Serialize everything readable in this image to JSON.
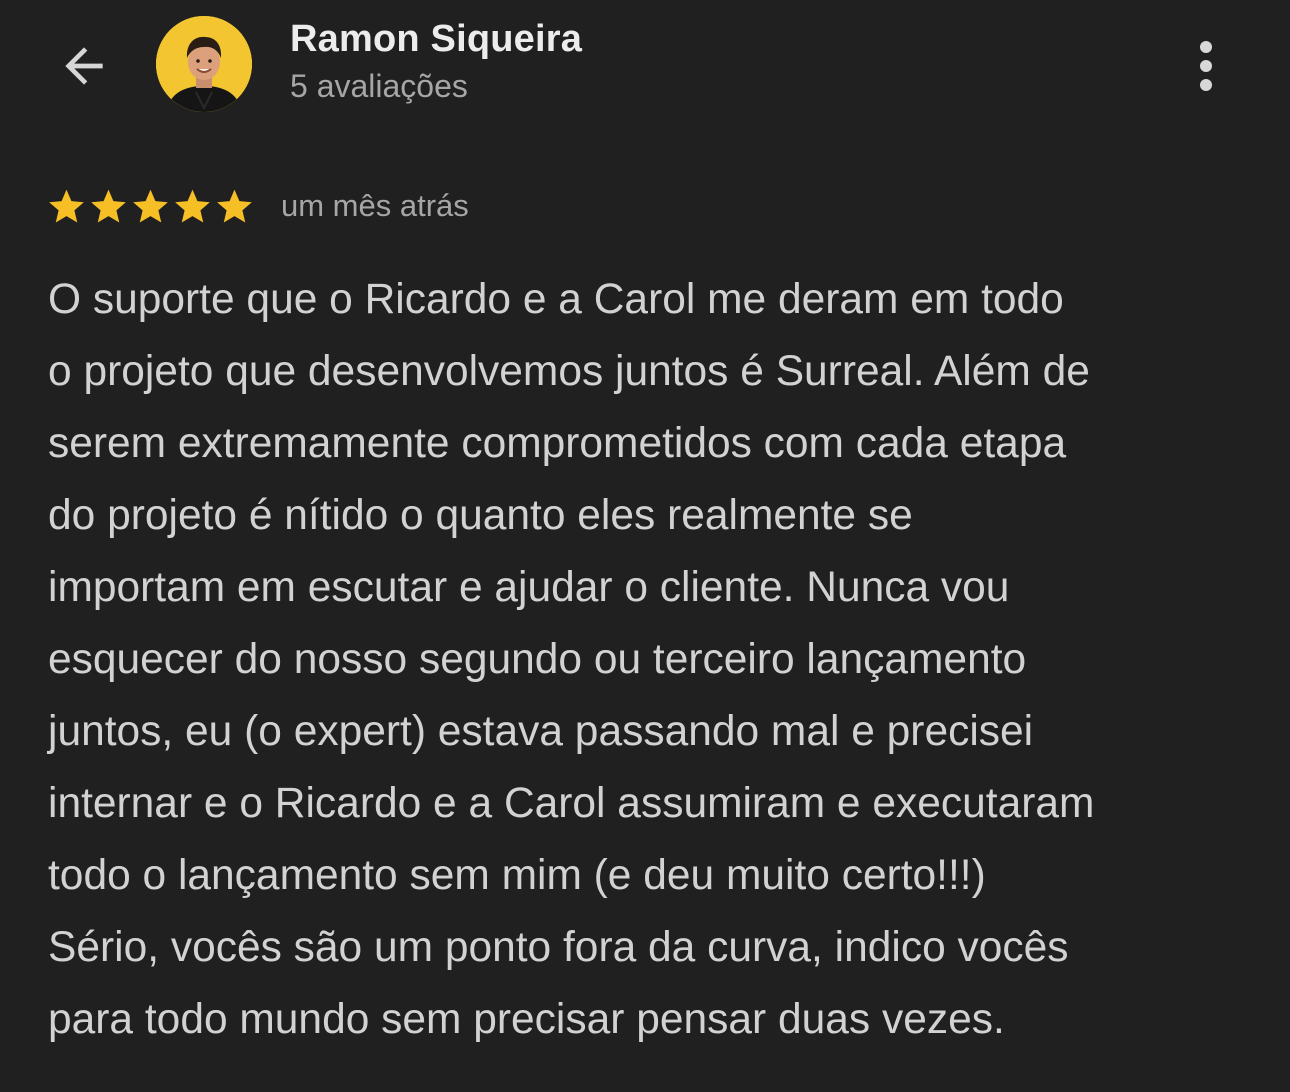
{
  "header": {
    "back_icon": "arrow-left-icon",
    "avatar_alt": "",
    "user_name": "Ramon Siqueira",
    "user_meta": "5 avaliações",
    "more_icon": "more-vert-icon"
  },
  "review": {
    "rating": 5,
    "max_rating": 5,
    "star_color": "#f6bf26",
    "time": "um mês atrás",
    "lines": [
      "O suporte que o Ricardo e a Carol me deram em todo",
      "o projeto que desenvolvemos juntos é Surreal. Além de",
      "serem extremamente comprometidos com cada etapa",
      "do projeto é nítido o quanto eles realmente se",
      "importam em escutar e ajudar o cliente. Nunca vou",
      "esquecer do nosso segundo ou terceiro lançamento",
      "juntos, eu (o expert) estava passando mal e precisei",
      "internar e o Ricardo e a Carol assumiram e executaram",
      "todo o lançamento sem mim (e deu muito certo!!!)",
      "Sério, vocês são um ponto fora da curva, indico vocês",
      "para todo mundo sem precisar pensar duas vezes."
    ]
  },
  "colors": {
    "background": "#202020",
    "text_primary": "#ececec",
    "text_secondary": "#a6a6a6",
    "avatar_bg": "#f2c531"
  }
}
